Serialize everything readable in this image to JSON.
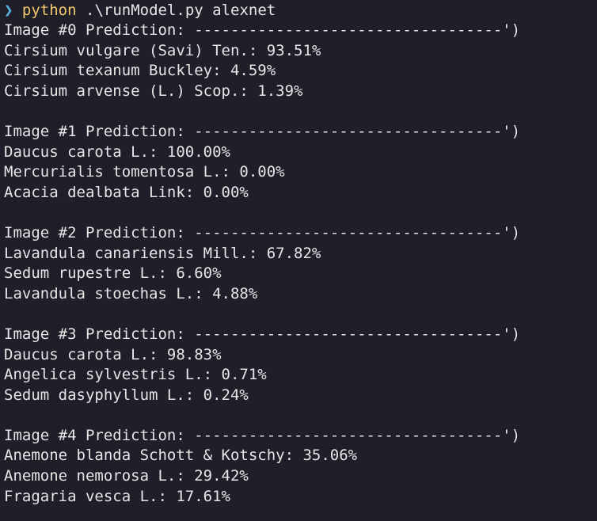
{
  "prompt": {
    "symbol": "❯",
    "command": "python",
    "args": ".\\runModel.py alexnet"
  },
  "colors": {
    "background": "#1e1f29",
    "text": "#e6e6e6",
    "prompt_symbol": "#59b3e6",
    "command": "#f3c76b"
  },
  "output": [
    {
      "header": "Image #0 Prediction: ----------------------------------')",
      "predictions": [
        "Cirsium vulgare (Savi) Ten.: 93.51%",
        "Cirsium texanum Buckley: 4.59%",
        "Cirsium arvense (L.) Scop.: 1.39%"
      ]
    },
    {
      "header": "Image #1 Prediction: ----------------------------------')",
      "predictions": [
        "Daucus carota L.: 100.00%",
        "Mercurialis tomentosa L.: 0.00%",
        "Acacia dealbata Link: 0.00%"
      ]
    },
    {
      "header": "Image #2 Prediction: ----------------------------------')",
      "predictions": [
        "Lavandula canariensis Mill.: 67.82%",
        "Sedum rupestre L.: 6.60%",
        "Lavandula stoechas L.: 4.88%"
      ]
    },
    {
      "header": "Image #3 Prediction: ----------------------------------')",
      "predictions": [
        "Daucus carota L.: 98.83%",
        "Angelica sylvestris L.: 0.71%",
        "Sedum dasyphyllum L.: 0.24%"
      ]
    },
    {
      "header": "Image #4 Prediction: ----------------------------------')",
      "predictions": [
        "Anemone blanda Schott & Kotschy: 35.06%",
        "Anemone nemorosa L.: 29.42%",
        "Fragaria vesca L.: 17.61%"
      ]
    }
  ]
}
